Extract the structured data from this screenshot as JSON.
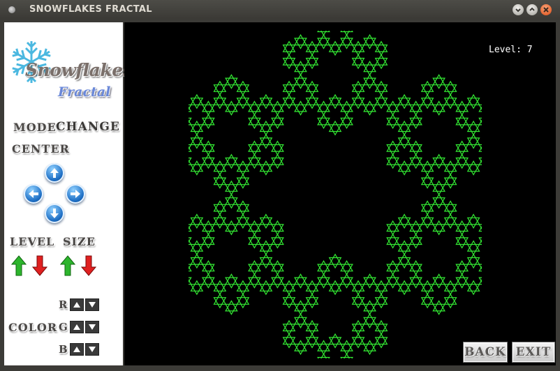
{
  "window": {
    "title": "SNOWFLAKES FRACTAL"
  },
  "logo": {
    "line1": "Snowflakes",
    "line2": "Fractal"
  },
  "sidebar": {
    "mode_label": "MODE",
    "change_label": "CHANGE",
    "center_label": "CENTER",
    "level_label": "LEVEL",
    "size_label": "SIZE",
    "color_label": "COLOR",
    "r_label": "R",
    "g_label": "G",
    "b_label": "B"
  },
  "canvas": {
    "level_text": "Level:  7",
    "fractal_color": "#33e833",
    "background_color": "#000000"
  },
  "buttons": {
    "back": "BACK",
    "exit": "EXIT"
  },
  "icons": {
    "center_up": "arrow-up-icon",
    "center_left": "arrow-left-icon",
    "center_right": "arrow-right-icon",
    "center_down": "arrow-down-icon",
    "level_up": "green-up-arrow-icon",
    "level_down": "red-down-arrow-icon"
  }
}
